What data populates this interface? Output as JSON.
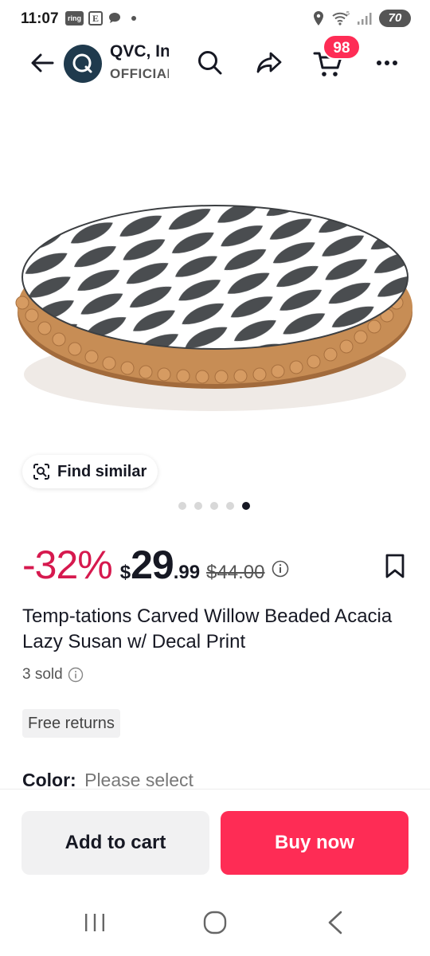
{
  "status_bar": {
    "time": "11:07",
    "left_icons": [
      "ring-icon",
      "e-icon",
      "chat-icon",
      "dot"
    ],
    "ring_label": "ring",
    "e_label": "E",
    "battery": "70"
  },
  "header": {
    "store_name": "QVC, Inc.",
    "store_subtitle": "OFFICIAL",
    "cart_count": "98",
    "logo_letter": "Q"
  },
  "product": {
    "find_similar_label": "Find similar",
    "carousel_total": 5,
    "carousel_active_index": 4,
    "discount": "-32%",
    "currency": "$",
    "price_int": "29",
    "price_dec": ".99",
    "original_price": "$44.00",
    "title": "Temp-tations Carved Willow Beaded Acacia Lazy Susan w/ Decal Print",
    "sold": "3 sold",
    "free_returns": "Free returns",
    "color_label": "Color:",
    "color_value": "Please select"
  },
  "actions": {
    "add_to_cart": "Add to cart",
    "buy_now": "Buy now"
  },
  "colors": {
    "accent": "#fe2c55",
    "discount": "#d6194e",
    "logo_bg": "#1f3a4d"
  }
}
